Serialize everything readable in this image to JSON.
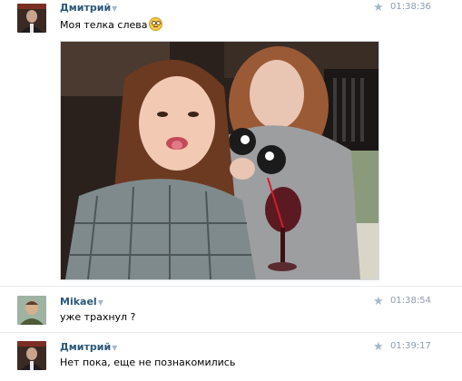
{
  "messages": [
    {
      "author": "Дмитрий",
      "caret": "▼",
      "time": "01:38:36",
      "text": "Моя телка слева",
      "has_emoji": true,
      "has_photo": true
    },
    {
      "author": "Mikael",
      "caret": "▼",
      "time": "01:38:54",
      "text": "уже трахнул ?"
    },
    {
      "author": "Дмитрий",
      "caret": "▼",
      "time": "01:39:17",
      "text": "Нет пока, еще не познакомились"
    }
  ],
  "icons": {
    "favorite": "star-icon",
    "menu": "chevron-down-icon",
    "emoji": "confused-face-emoji-icon"
  },
  "colors": {
    "author_link": "#2b587a",
    "time": "#8e9bab",
    "star": "#a6b7c9",
    "separator": "#e7eaed"
  }
}
